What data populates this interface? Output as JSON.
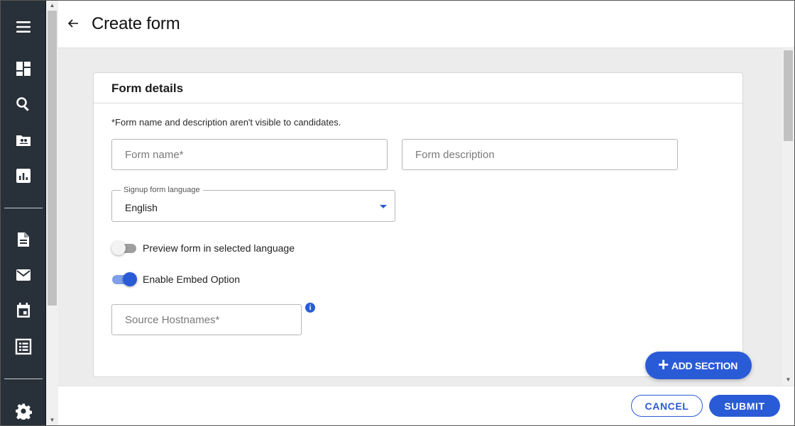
{
  "header": {
    "title": "Create form"
  },
  "nav": {
    "icons": [
      "menu-icon",
      "dashboard-icon",
      "search-icon",
      "candidates-folder-icon",
      "reports-icon",
      "document-icon",
      "mail-icon",
      "calendar-icon",
      "list-icon",
      "settings-icon"
    ]
  },
  "form_details": {
    "heading": "Form details",
    "note": "*Form name and description aren't visible to candidates.",
    "name_placeholder": "Form name*",
    "description_placeholder": "Form description",
    "language": {
      "label": "Signup form language",
      "value": "English"
    },
    "preview_toggle": {
      "label": "Preview form in selected language",
      "state": "off"
    },
    "embed_toggle": {
      "label": "Enable Embed Option",
      "state": "on"
    },
    "hostnames_placeholder": "Source Hostnames*"
  },
  "add_section": {
    "label": "ADD SECTION"
  },
  "footer": {
    "cancel": "CANCEL",
    "submit": "SUBMIT"
  },
  "colors": {
    "accent": "#2a5bd7",
    "rail": "#283039",
    "content_bg": "#ececed"
  }
}
